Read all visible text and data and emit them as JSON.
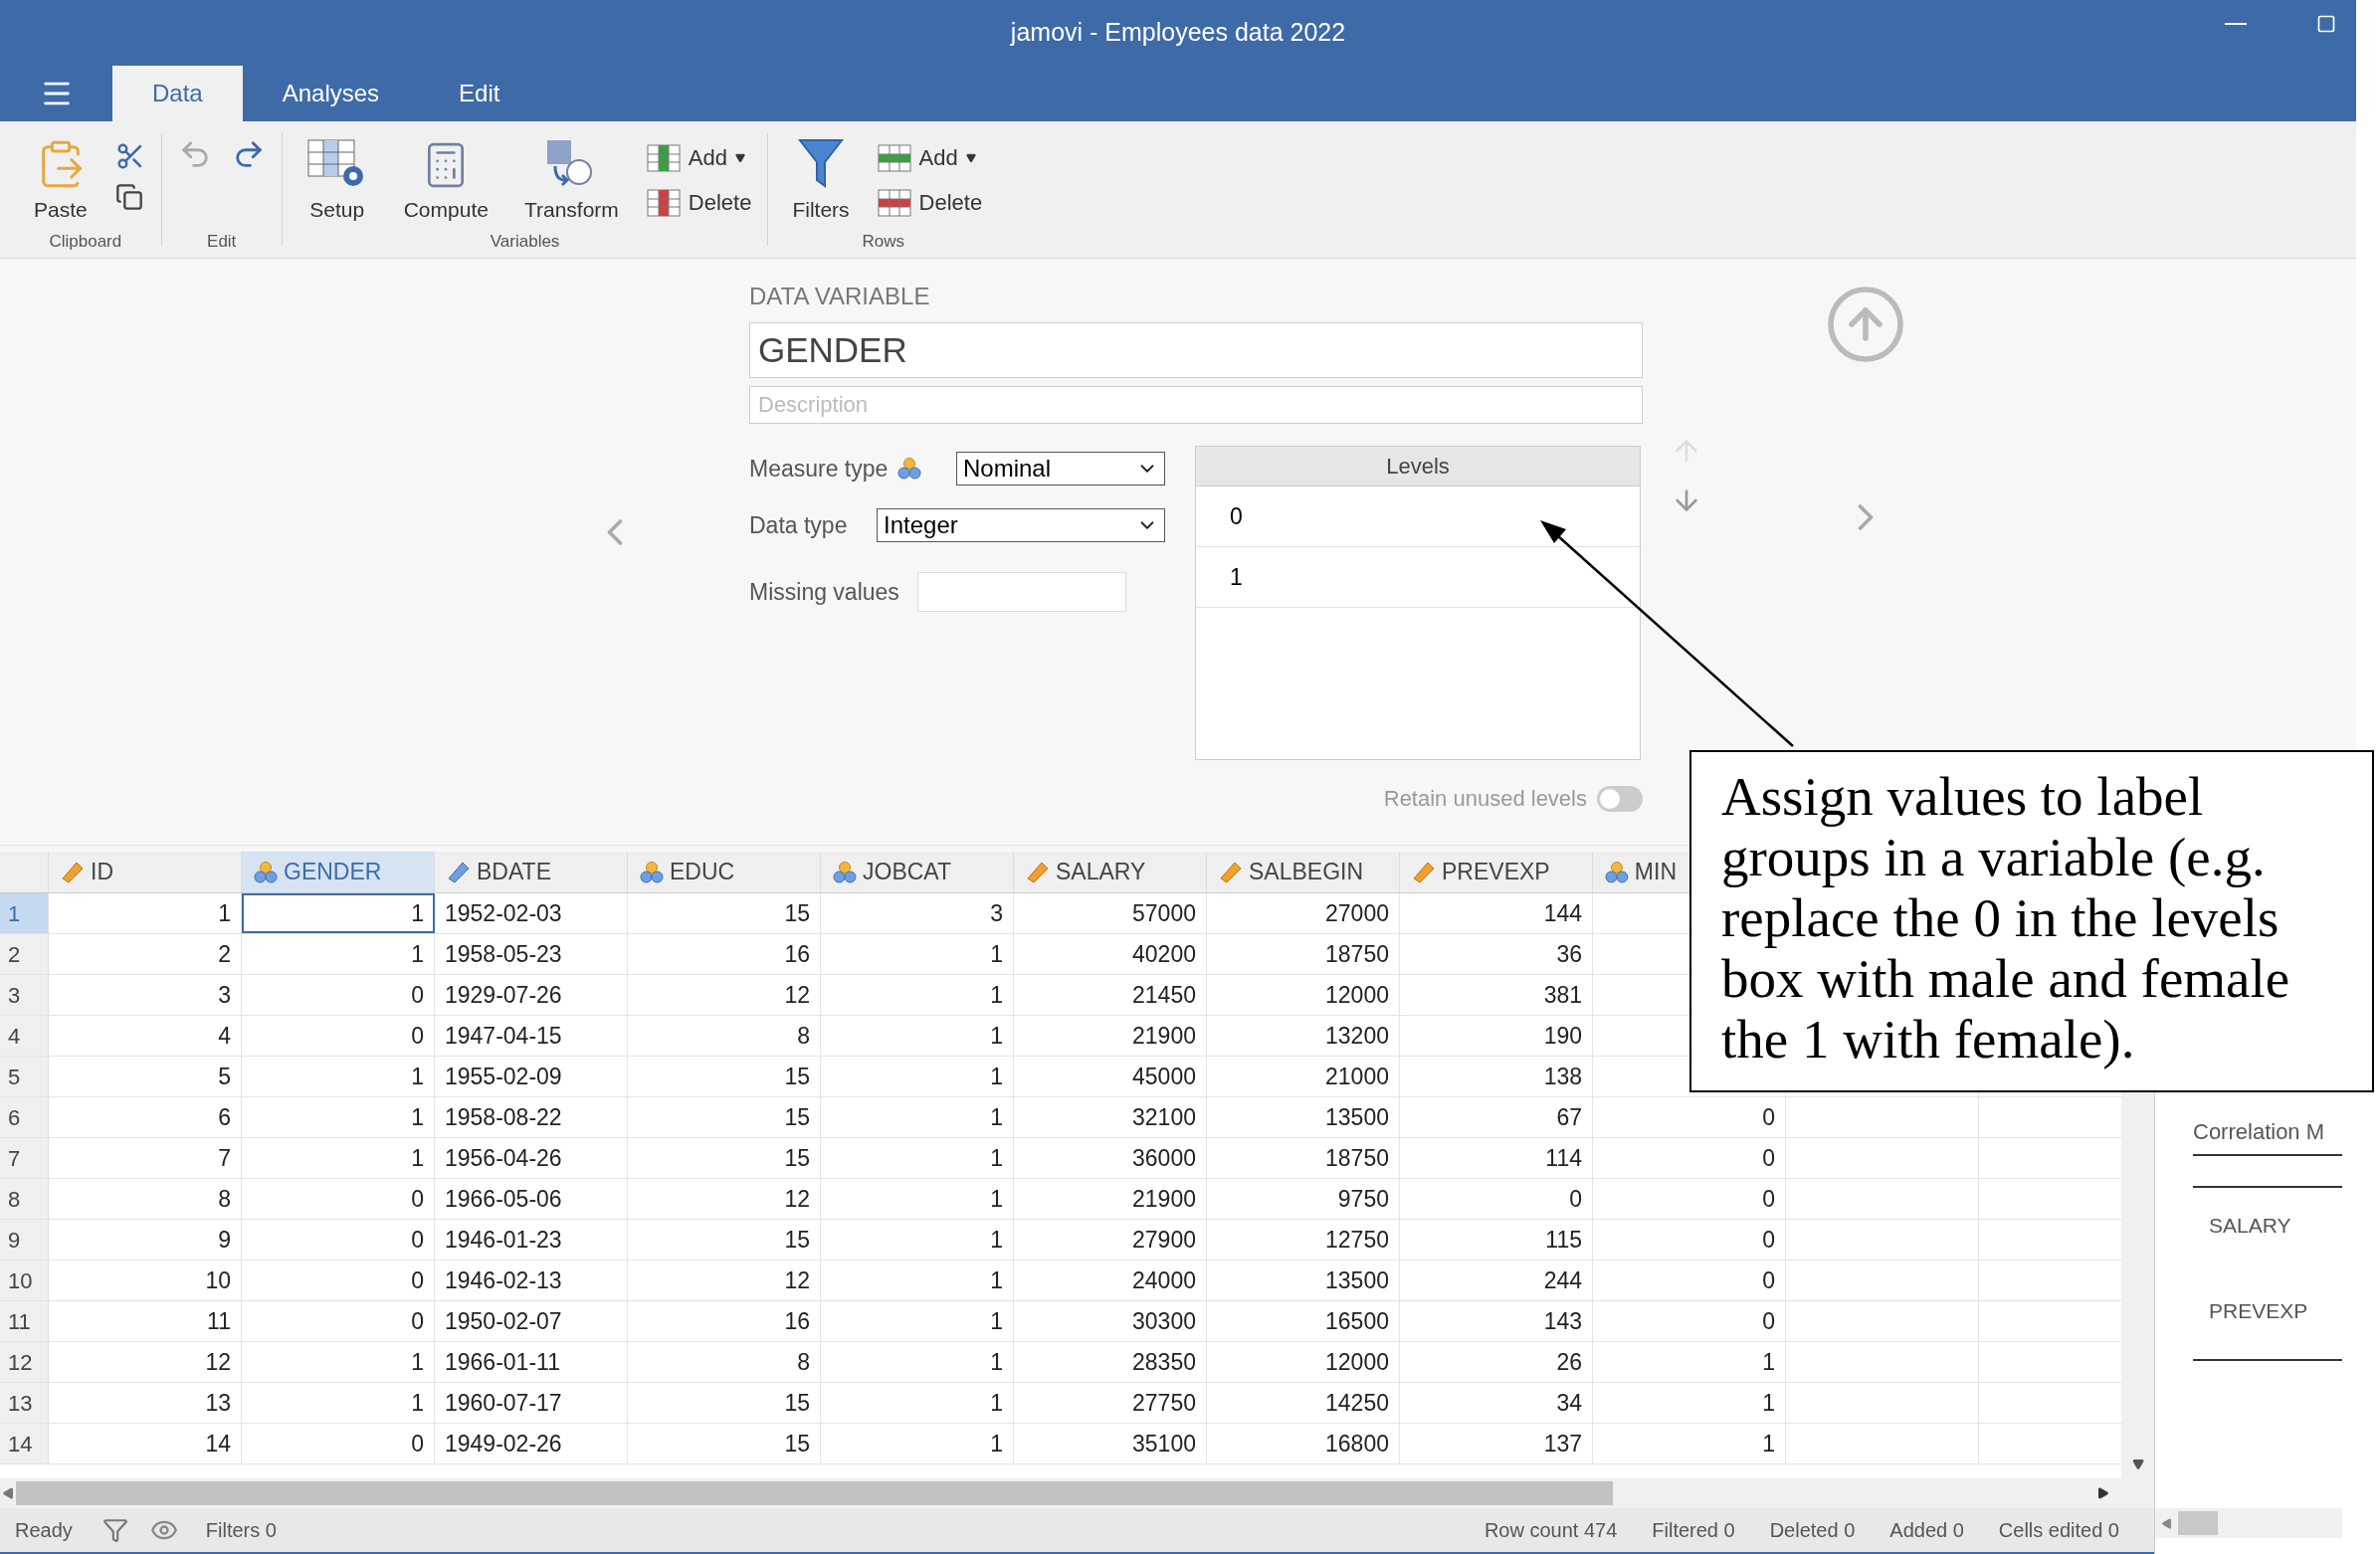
{
  "window": {
    "title": "jamovi - Employees data 2022"
  },
  "tabs": [
    {
      "label": "Data",
      "selected": true
    },
    {
      "label": "Analyses",
      "selected": false
    },
    {
      "label": "Edit",
      "selected": false
    }
  ],
  "toolbar": {
    "groups": [
      {
        "label": "Clipboard",
        "items": [
          {
            "kind": "paste",
            "label": "Paste"
          },
          {
            "kind": "cut"
          },
          {
            "kind": "copy"
          }
        ]
      },
      {
        "label": "Edit",
        "items": [
          {
            "kind": "undo",
            "disabled": true
          },
          {
            "kind": "redo",
            "disabled": false
          }
        ]
      },
      {
        "label": "Variables",
        "items": [
          {
            "kind": "setup",
            "label": "Setup"
          },
          {
            "kind": "compute",
            "label": "Compute"
          },
          {
            "kind": "transform",
            "label": "Transform"
          },
          {
            "kind": "add-variable",
            "label": "Add"
          },
          {
            "kind": "delete-variable",
            "label": "Delete"
          }
        ]
      },
      {
        "label": "Rows",
        "items": [
          {
            "kind": "filters",
            "label": "Filters"
          },
          {
            "kind": "add-row",
            "label": "Add"
          },
          {
            "kind": "delete-row",
            "label": "Delete"
          }
        ]
      }
    ]
  },
  "variable_editor": {
    "heading": "DATA VARIABLE",
    "name": "GENDER",
    "description": {
      "placeholder": "Description"
    },
    "measure_type": {
      "label": "Measure type",
      "value": "Nominal",
      "kind": "nominal"
    },
    "data_type": {
      "label": "Data type",
      "value": "Integer"
    },
    "missing_values": {
      "label": "Missing values"
    },
    "levels": {
      "title": "Levels",
      "items": [
        "0",
        "1"
      ],
      "move_up_disabled": true,
      "move_down_disabled": false
    },
    "retain_unused_levels": {
      "label": "Retain unused levels",
      "on": false
    }
  },
  "grid": {
    "columns": [
      {
        "name": "ID",
        "kind": "continuous",
        "selected": false
      },
      {
        "name": "GENDER",
        "kind": "nominal",
        "selected": true
      },
      {
        "name": "BDATE",
        "kind": "text",
        "selected": false
      },
      {
        "name": "EDUC",
        "kind": "nominal",
        "selected": false
      },
      {
        "name": "JOBCAT",
        "kind": "nominal",
        "selected": false
      },
      {
        "name": "SALARY",
        "kind": "continuous",
        "selected": false
      },
      {
        "name": "SALBEGIN",
        "kind": "continuous",
        "selected": false
      },
      {
        "name": "PREVEXP",
        "kind": "continuous",
        "selected": false
      },
      {
        "name": "MIN",
        "kind": "nominal",
        "selected": false
      }
    ],
    "rows": [
      {
        "number": "1",
        "selected": true,
        "cells": [
          "1",
          "1",
          "1952-02-03",
          "15",
          "3",
          "57000",
          "27000",
          "144"
        ]
      },
      {
        "number": "2",
        "selected": false,
        "cells": [
          "2",
          "1",
          "1958-05-23",
          "16",
          "1",
          "40200",
          "18750",
          "36"
        ]
      },
      {
        "number": "3",
        "selected": false,
        "cells": [
          "3",
          "0",
          "1929-07-26",
          "12",
          "1",
          "21450",
          "12000",
          "381"
        ]
      },
      {
        "number": "4",
        "selected": false,
        "cells": [
          "4",
          "0",
          "1947-04-15",
          "8",
          "1",
          "21900",
          "13200",
          "190"
        ]
      },
      {
        "number": "5",
        "selected": false,
        "cells": [
          "5",
          "1",
          "1955-02-09",
          "15",
          "1",
          "45000",
          "21000",
          "138"
        ]
      },
      {
        "number": "6",
        "selected": false,
        "cells": [
          "6",
          "1",
          "1958-08-22",
          "15",
          "1",
          "32100",
          "13500",
          "67",
          "0"
        ]
      },
      {
        "number": "7",
        "selected": false,
        "cells": [
          "7",
          "1",
          "1956-04-26",
          "15",
          "1",
          "36000",
          "18750",
          "114",
          "0"
        ]
      },
      {
        "number": "8",
        "selected": false,
        "cells": [
          "8",
          "0",
          "1966-05-06",
          "12",
          "1",
          "21900",
          "9750",
          "0",
          "0"
        ]
      },
      {
        "number": "9",
        "selected": false,
        "cells": [
          "9",
          "0",
          "1946-01-23",
          "15",
          "1",
          "27900",
          "12750",
          "115",
          "0"
        ]
      },
      {
        "number": "10",
        "selected": false,
        "cells": [
          "10",
          "0",
          "1946-02-13",
          "12",
          "1",
          "24000",
          "13500",
          "244",
          "0"
        ]
      },
      {
        "number": "11",
        "selected": false,
        "cells": [
          "11",
          "0",
          "1950-02-07",
          "16",
          "1",
          "30300",
          "16500",
          "143",
          "0"
        ]
      },
      {
        "number": "12",
        "selected": false,
        "cells": [
          "12",
          "1",
          "1966-01-11",
          "8",
          "1",
          "28350",
          "12000",
          "26",
          "1"
        ]
      },
      {
        "number": "13",
        "selected": false,
        "cells": [
          "13",
          "1",
          "1960-07-17",
          "15",
          "1",
          "27750",
          "14250",
          "34",
          "1"
        ]
      },
      {
        "number": "14",
        "selected": false,
        "cells": [
          "14",
          "0",
          "1949-02-26",
          "15",
          "1",
          "35100",
          "16800",
          "137",
          "1"
        ]
      }
    ]
  },
  "results_panel": {
    "items": [
      "Correlation M",
      "SALARY",
      "PREVEXP"
    ]
  },
  "status_bar": {
    "status": "Ready",
    "filters": "Filters 0",
    "counts": [
      "Row count 474",
      "Filtered 0",
      "Deleted 0",
      "Added 0",
      "Cells edited 0"
    ]
  },
  "callout": {
    "text": "Assign values to label groups in a variable (e.g. replace the 0 in the levels box with male and female the 1 with female)."
  }
}
